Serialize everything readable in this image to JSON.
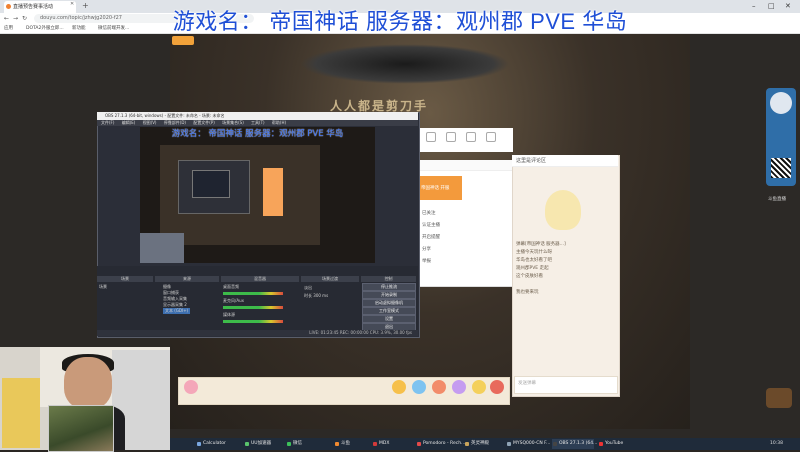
{
  "overlay": {
    "title": "游戏名：   帝国神话 服务器：观州郡 PVE 华岛"
  },
  "browser": {
    "tab_title": "直播预告赛事活动",
    "url": "douyu.com/topic/jzhwjg2020-f27",
    "bookmarks": [
      "应用",
      "DOTA2外服立即...",
      "新功能",
      "微信前端开发..."
    ]
  },
  "stage": {
    "text": "人人都是剪刀手"
  },
  "chat": {
    "header": "这里是评论区",
    "lines": [
      "弹幕[帝国神话 服务器...]",
      "主播今天玩什么呀",
      "华岛也太好看了吧",
      "观州郡PVE 走起",
      "这个皮肤好看",
      "我也要来玩"
    ],
    "footer": "发送弹幕"
  },
  "popup": {
    "orange_label": "帝国神话 开服",
    "lines": [
      "已关注",
      "认证主播",
      "开启提醒",
      "分享",
      "举报"
    ]
  },
  "obs": {
    "title": "OBS 27.1.3 (64-bit, windows) - 配置文件: 未命名 - 场景: 未命名",
    "menu": [
      "文件(F)",
      "编辑(E)",
      "视图(V)",
      "停靠部件(D)",
      "配置文件(P)",
      "场景集合(S)",
      "工具(T)",
      "帮助(H)"
    ],
    "inner_title": "游戏名： 帝国神话 服务器：观州郡 PVE 华岛",
    "docks": [
      "场景",
      "来源",
      "混音器",
      "场景过渡",
      "控制"
    ],
    "scenes": [
      "场景"
    ],
    "sources": [
      "摄像",
      "窗口捕获",
      "音频输入采集",
      "显示器采集 2",
      "文本 (GDI+)"
    ],
    "mixer": [
      "桌面音频",
      "麦克风/Aux",
      "媒体源"
    ],
    "transition": [
      "淡出",
      "时长 300 ms"
    ],
    "controls": [
      "停止推流",
      "开始录制",
      "启动虚拟摄像机",
      "工作室模式",
      "设置",
      "退出"
    ],
    "status": "LIVE: 01:23:45   REC: 00:00:00   CPU: 3.9%, 30.00 fps"
  },
  "side": {
    "label": "斗鱼直播"
  },
  "taskbar": {
    "items": [
      "Calculator",
      "UU加速器",
      "微信",
      "斗鱼",
      "MDX",
      "Pomodoro - Rech...",
      "英灵神殿",
      "MYSQ000-CN F...",
      "OBS 27.1.3 (64...",
      "YouTube"
    ],
    "time": "10:38"
  }
}
